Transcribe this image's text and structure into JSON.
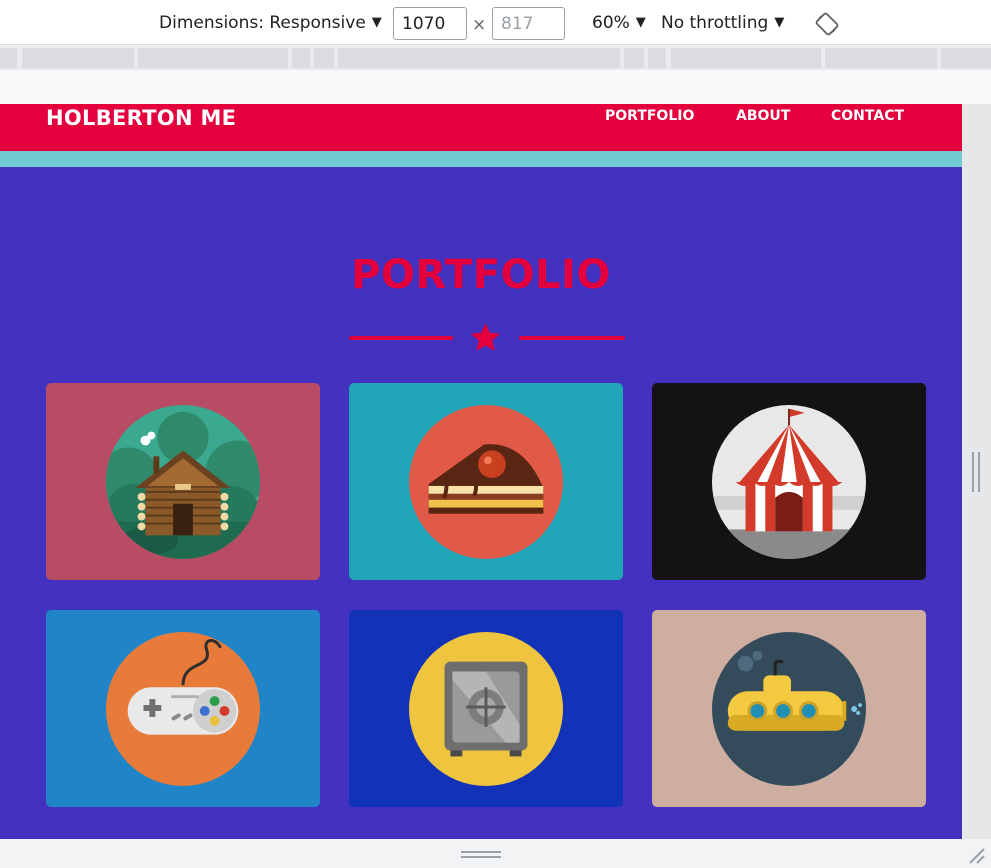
{
  "devtools": {
    "dimensions_label": "Dimensions: Responsive",
    "width_value": "1070",
    "height_placeholder": "817",
    "times_symbol": "×",
    "zoom_label": "60%",
    "throttle_label": "No throttling",
    "caret": "▼"
  },
  "site": {
    "brand": "HOLBERTON ME",
    "nav": [
      "PORTFOLIO",
      "ABOUT",
      "CONTACT"
    ],
    "section_title": "PORTFOLIO"
  },
  "cards": [
    {
      "icon": "log-cabin-icon",
      "bg": "#b84c64",
      "circle": "#3aa98f"
    },
    {
      "icon": "cake-slice-icon",
      "bg": "#20a5b8",
      "circle": "#e05a47"
    },
    {
      "icon": "circus-tent-icon",
      "bg": "#141212",
      "circle": "#e8e8e8"
    },
    {
      "icon": "game-controller-icon",
      "bg": "#1f85c8",
      "circle": "#e97b3a"
    },
    {
      "icon": "safe-icon",
      "bg": "#1233b8",
      "circle": "#efc43e"
    },
    {
      "icon": "submarine-icon",
      "bg": "#cdaea0",
      "circle": "#344b5c"
    }
  ],
  "colors": {
    "header": "#e3003c",
    "teal": "#72c9d0",
    "page_bg": "#4331bf"
  }
}
